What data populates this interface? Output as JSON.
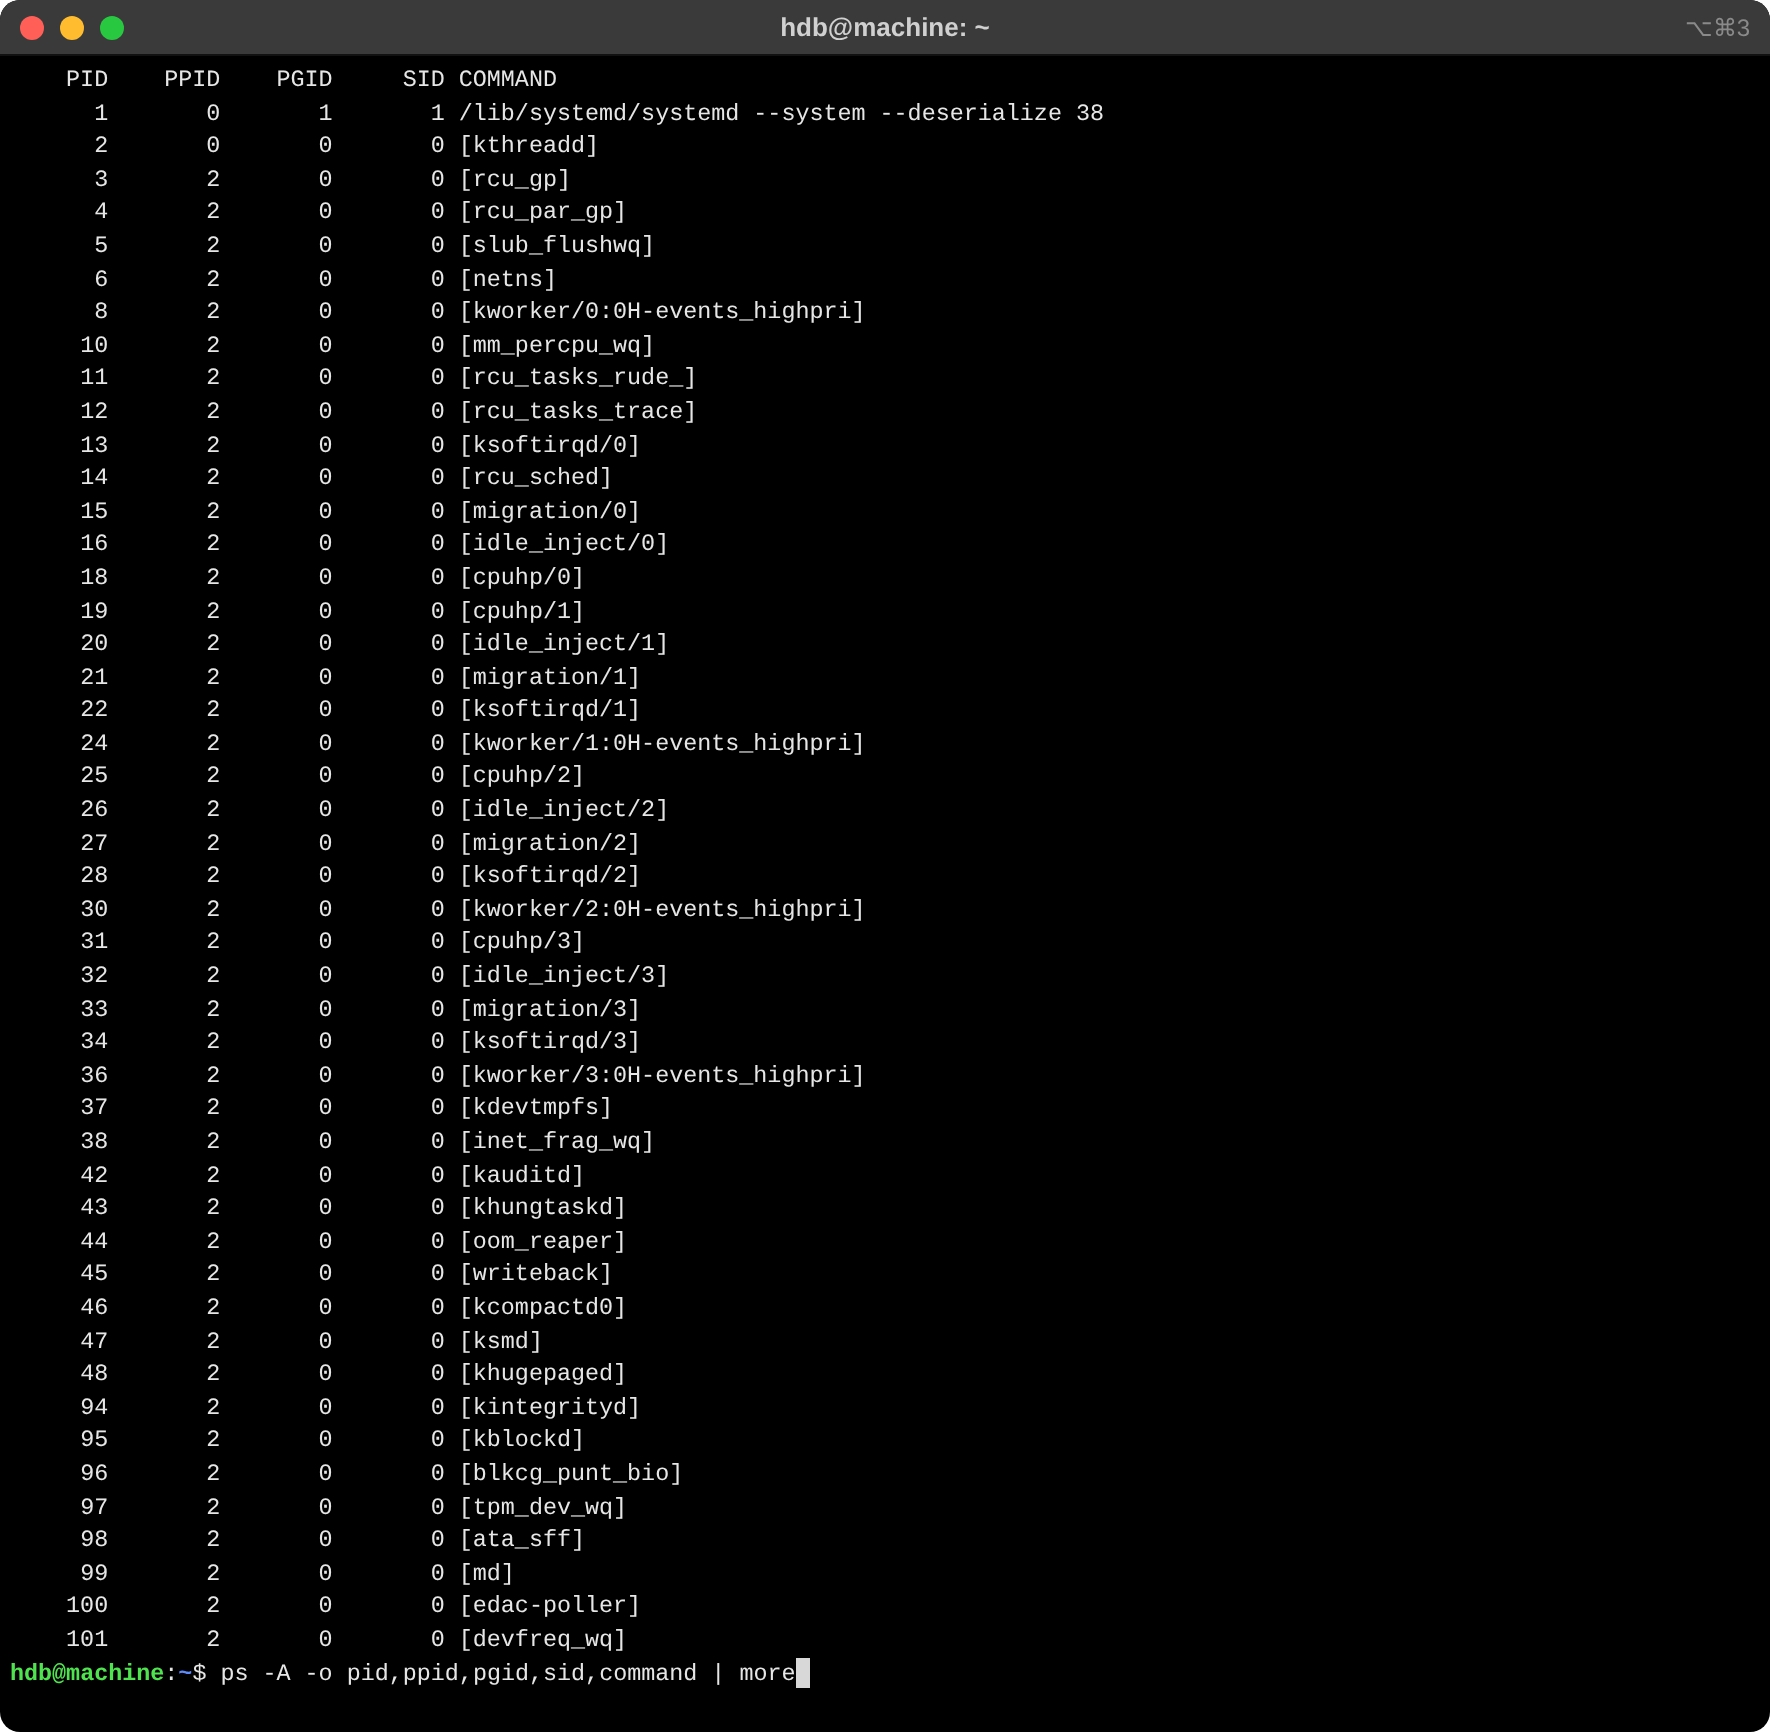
{
  "window": {
    "title": "hdb@machine: ~",
    "shortcut": "⌥⌘3"
  },
  "table": {
    "columns": [
      "PID",
      "PPID",
      "PGID",
      "SID",
      "COMMAND"
    ],
    "rows": [
      [
        "1",
        "0",
        "1",
        "1",
        "/lib/systemd/systemd --system --deserialize 38"
      ],
      [
        "2",
        "0",
        "0",
        "0",
        "[kthreadd]"
      ],
      [
        "3",
        "2",
        "0",
        "0",
        "[rcu_gp]"
      ],
      [
        "4",
        "2",
        "0",
        "0",
        "[rcu_par_gp]"
      ],
      [
        "5",
        "2",
        "0",
        "0",
        "[slub_flushwq]"
      ],
      [
        "6",
        "2",
        "0",
        "0",
        "[netns]"
      ],
      [
        "8",
        "2",
        "0",
        "0",
        "[kworker/0:0H-events_highpri]"
      ],
      [
        "10",
        "2",
        "0",
        "0",
        "[mm_percpu_wq]"
      ],
      [
        "11",
        "2",
        "0",
        "0",
        "[rcu_tasks_rude_]"
      ],
      [
        "12",
        "2",
        "0",
        "0",
        "[rcu_tasks_trace]"
      ],
      [
        "13",
        "2",
        "0",
        "0",
        "[ksoftirqd/0]"
      ],
      [
        "14",
        "2",
        "0",
        "0",
        "[rcu_sched]"
      ],
      [
        "15",
        "2",
        "0",
        "0",
        "[migration/0]"
      ],
      [
        "16",
        "2",
        "0",
        "0",
        "[idle_inject/0]"
      ],
      [
        "18",
        "2",
        "0",
        "0",
        "[cpuhp/0]"
      ],
      [
        "19",
        "2",
        "0",
        "0",
        "[cpuhp/1]"
      ],
      [
        "20",
        "2",
        "0",
        "0",
        "[idle_inject/1]"
      ],
      [
        "21",
        "2",
        "0",
        "0",
        "[migration/1]"
      ],
      [
        "22",
        "2",
        "0",
        "0",
        "[ksoftirqd/1]"
      ],
      [
        "24",
        "2",
        "0",
        "0",
        "[kworker/1:0H-events_highpri]"
      ],
      [
        "25",
        "2",
        "0",
        "0",
        "[cpuhp/2]"
      ],
      [
        "26",
        "2",
        "0",
        "0",
        "[idle_inject/2]"
      ],
      [
        "27",
        "2",
        "0",
        "0",
        "[migration/2]"
      ],
      [
        "28",
        "2",
        "0",
        "0",
        "[ksoftirqd/2]"
      ],
      [
        "30",
        "2",
        "0",
        "0",
        "[kworker/2:0H-events_highpri]"
      ],
      [
        "31",
        "2",
        "0",
        "0",
        "[cpuhp/3]"
      ],
      [
        "32",
        "2",
        "0",
        "0",
        "[idle_inject/3]"
      ],
      [
        "33",
        "2",
        "0",
        "0",
        "[migration/3]"
      ],
      [
        "34",
        "2",
        "0",
        "0",
        "[ksoftirqd/3]"
      ],
      [
        "36",
        "2",
        "0",
        "0",
        "[kworker/3:0H-events_highpri]"
      ],
      [
        "37",
        "2",
        "0",
        "0",
        "[kdevtmpfs]"
      ],
      [
        "38",
        "2",
        "0",
        "0",
        "[inet_frag_wq]"
      ],
      [
        "42",
        "2",
        "0",
        "0",
        "[kauditd]"
      ],
      [
        "43",
        "2",
        "0",
        "0",
        "[khungtaskd]"
      ],
      [
        "44",
        "2",
        "0",
        "0",
        "[oom_reaper]"
      ],
      [
        "45",
        "2",
        "0",
        "0",
        "[writeback]"
      ],
      [
        "46",
        "2",
        "0",
        "0",
        "[kcompactd0]"
      ],
      [
        "47",
        "2",
        "0",
        "0",
        "[ksmd]"
      ],
      [
        "48",
        "2",
        "0",
        "0",
        "[khugepaged]"
      ],
      [
        "94",
        "2",
        "0",
        "0",
        "[kintegrityd]"
      ],
      [
        "95",
        "2",
        "0",
        "0",
        "[kblockd]"
      ],
      [
        "96",
        "2",
        "0",
        "0",
        "[blkcg_punt_bio]"
      ],
      [
        "97",
        "2",
        "0",
        "0",
        "[tpm_dev_wq]"
      ],
      [
        "98",
        "2",
        "0",
        "0",
        "[ata_sff]"
      ],
      [
        "99",
        "2",
        "0",
        "0",
        "[md]"
      ],
      [
        "100",
        "2",
        "0",
        "0",
        "[edac-poller]"
      ],
      [
        "101",
        "2",
        "0",
        "0",
        "[devfreq_wq]"
      ]
    ]
  },
  "prompt": {
    "user_host": "hdb@machine",
    "separator": ":",
    "path": "~",
    "symbol": "$",
    "command": "ps -A -o pid,ppid,pgid,sid,command | more"
  }
}
